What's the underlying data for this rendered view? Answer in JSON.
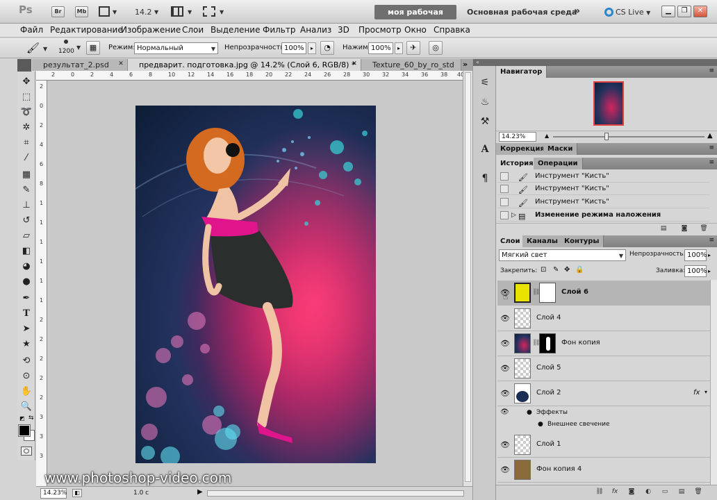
{
  "appbar": {
    "logo": "Ps",
    "btn_br": "Br",
    "btn_mb": "Mb",
    "zoom_value": "14.2",
    "workspace_active": "моя рабочая среда",
    "workspace_basic": "Основная рабочая среда",
    "more": "»",
    "cs_live": "CS Live",
    "cs_live_icon": "cs-live-ring-icon"
  },
  "menu": [
    "Файл",
    "Редактирование",
    "Изображение",
    "Слои",
    "Выделение",
    "Фильтр",
    "Анализ",
    "3D",
    "Просмотр",
    "Окно",
    "Справка"
  ],
  "options": {
    "brush_size": "1200",
    "mode_label": "Режим:",
    "mode_value": "Нормальный",
    "opacity_label": "Непрозрачность:",
    "opacity_value": "100%",
    "flow_label": "Нажим:",
    "flow_value": "100%"
  },
  "tabs": [
    {
      "label": "результат_2.psd",
      "active": false
    },
    {
      "label": "предварит. подготовка.jpg @ 14.2% (Слой 6, RGB/8) *",
      "active": true
    },
    {
      "label": "Texture_60_by_ro_std",
      "active": false
    }
  ],
  "rulers": {
    "top": [
      "2",
      "0",
      "2",
      "4",
      "6",
      "8",
      "10",
      "12",
      "14",
      "16",
      "18",
      "20",
      "22",
      "24",
      "26",
      "28",
      "30",
      "32",
      "34",
      "36",
      "38",
      "40"
    ],
    "left": [
      "2",
      "0",
      "2",
      "4",
      "6",
      "8",
      "1",
      "1",
      "1",
      "1",
      "1",
      "1",
      "2",
      "2",
      "2",
      "2",
      "2",
      "3",
      "3",
      "3"
    ]
  },
  "canvas": {
    "watermark": "www.photoshop-video.com"
  },
  "status": {
    "zoom": "14.23%",
    "info": "1.0 с"
  },
  "navigator": {
    "title": "Навигатор",
    "zoom": "14.23%"
  },
  "adjust_tabs": [
    "Коррекция",
    "Маски"
  ],
  "history": {
    "tabs": [
      "История",
      "Операции"
    ],
    "items": [
      "Инструмент \"Кисть\"",
      "Инструмент \"Кисть\"",
      "Инструмент \"Кисть\"",
      "Изменение режима наложения"
    ]
  },
  "layers": {
    "tabs": [
      "Слои",
      "Каналы",
      "Контуры"
    ],
    "blend_mode": "Мягкий свет",
    "opacity_label": "Непрозрачность:",
    "opacity_value": "100%",
    "lock_label": "Закрепить:",
    "fill_label": "Заливка:",
    "fill_value": "100%",
    "rows": [
      {
        "name": "Слой 6",
        "selected": true
      },
      {
        "name": "Слой 4"
      },
      {
        "name": "Фон копия"
      },
      {
        "name": "Слой 5"
      },
      {
        "name": "Слой 2",
        "fx": "fx"
      },
      {
        "name": "Эффекты",
        "sub": true
      },
      {
        "name": "Внешнее свечение",
        "sub": true
      },
      {
        "name": "Слой 1"
      },
      {
        "name": "Фон копия 4"
      }
    ]
  },
  "colors": {
    "ws_active_bg": "#6f6f6f",
    "cs_live_blue": "#2a86c8",
    "photo_pink": "#d2255f",
    "photo_navy": "#0c1d35"
  }
}
